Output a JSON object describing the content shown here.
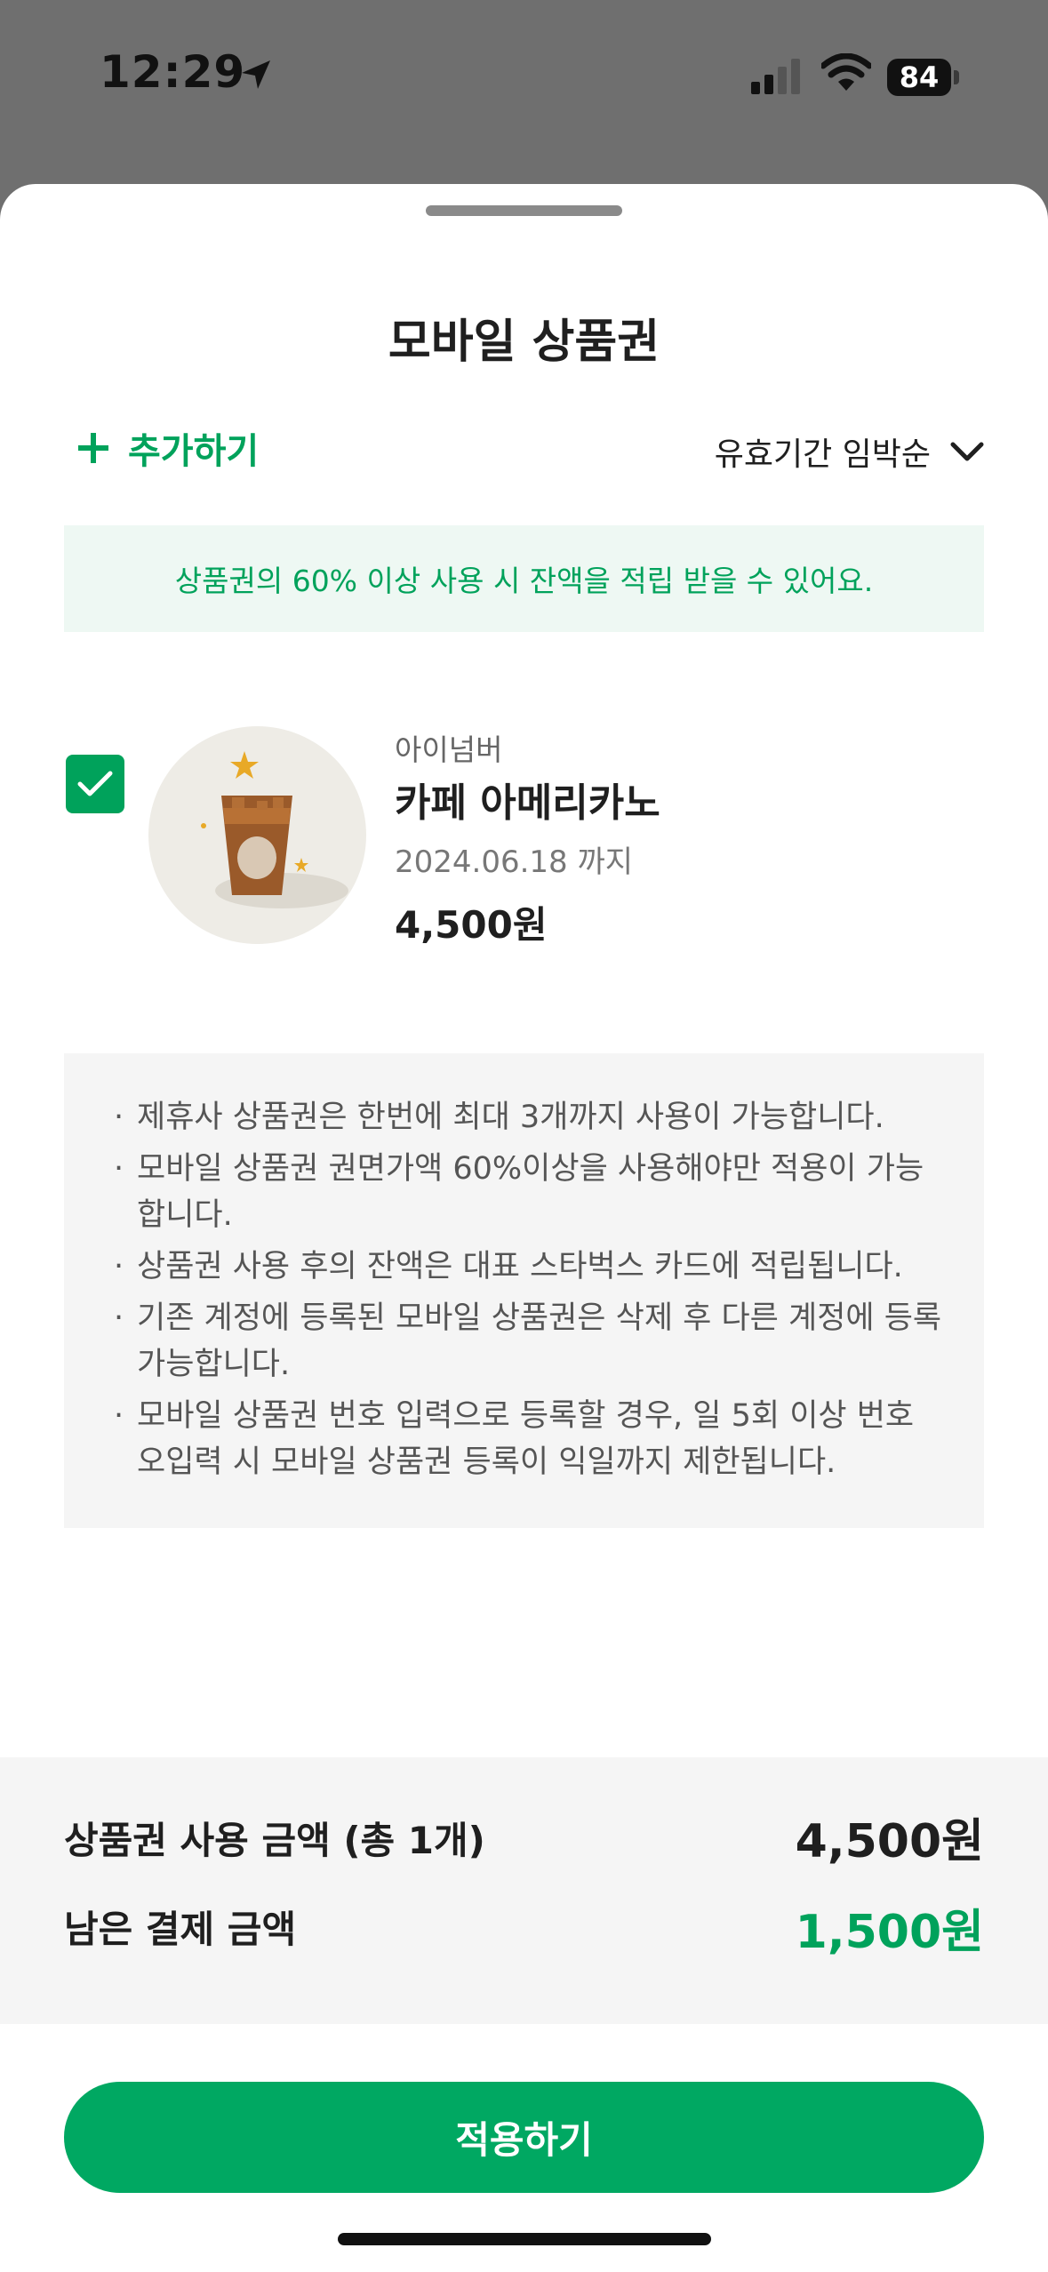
{
  "status_bar": {
    "time": "12:29",
    "battery": "84",
    "icons": [
      "location-arrow-icon",
      "signal-icon",
      "wifi-icon",
      "battery-icon"
    ]
  },
  "sheet": {
    "title": "모바일 상품권",
    "add_label": "추가하기",
    "sort_label": "유효기간 임박순",
    "notice": "상품권의 60% 이상 사용 시 잔액을 적립 받을 수 있어요."
  },
  "voucher": {
    "checked": true,
    "brand": "아이넘버",
    "name": "카페 아메리카노",
    "expiry": "2024.06.18 까지",
    "price": "4,500원"
  },
  "info": [
    "제휴사 상품권은 한번에 최대 3개까지 사용이 가능합니다.",
    "모바일 상품권 권면가액 60%이상을 사용해야만 적용이 가능합니다.",
    "상품권 사용 후의 잔액은 대표 스타벅스 카드에 적립됩니다.",
    "기존 계정에 등록된 모바일 상품권은 삭제 후 다른 계정에 등록 가능합니다.",
    "모바일 상품권 번호 입력으로 등록할 경우, 일 5회 이상 번호 오입력 시 모바일 상품권 등록이 익일까지 제한됩니다."
  ],
  "summary": {
    "used_label": "상품권 사용 금액 (총 1개)",
    "used_value": "4,500원",
    "remaining_label": "남은 결제 금액",
    "remaining_value": "1,500원"
  },
  "apply_label": "적용하기",
  "colors": {
    "brand_green": "#00a25b",
    "notice_bg": "#eef8f3",
    "info_bg": "#f5f5f5"
  }
}
